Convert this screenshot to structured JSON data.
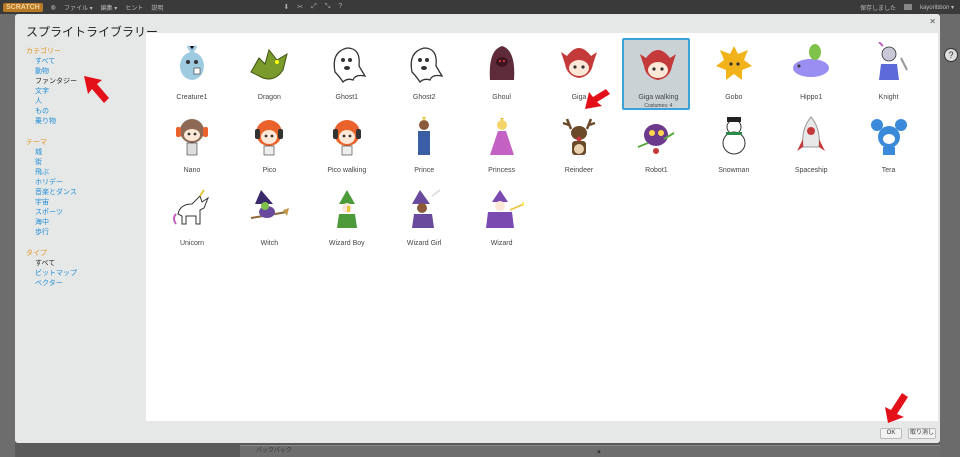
{
  "topbar": {
    "logo": "SCRATCH",
    "menus": [
      "ファイル ▾",
      "編集 ▾",
      "ヒント",
      "説明"
    ],
    "right_text": "保存しました",
    "user": "kayoribbon ▾"
  },
  "background": {
    "backpack_label": "バックパック"
  },
  "dialog": {
    "title": "スプライトライブラリー",
    "ok_label": "OK",
    "cancel_label": "取り消し"
  },
  "sidebar": {
    "category_heading": "カテゴリー",
    "categories": [
      "すべて",
      "動物",
      "ファンタジー",
      "文字",
      "人",
      "もの",
      "乗り物"
    ],
    "theme_heading": "テーマ",
    "themes": [
      "城",
      "街",
      "飛ぶ",
      "ホリデー",
      "音楽とダンス",
      "宇宙",
      "スポーツ",
      "海中",
      "歩行"
    ],
    "type_heading": "タイプ",
    "types": [
      "すべて",
      "ビットマップ",
      "ベクター"
    ]
  },
  "sprites": [
    {
      "name": "Creature1",
      "icon": "creature-icon",
      "color": "#9fcbe0"
    },
    {
      "name": "Dragon",
      "icon": "dragon-icon",
      "color": "#7a9a2c"
    },
    {
      "name": "Ghost1",
      "icon": "ghost-icon",
      "color": "#ffffff"
    },
    {
      "name": "Ghost2",
      "icon": "ghost-icon",
      "color": "#ffffff"
    },
    {
      "name": "Ghoul",
      "icon": "ghoul-icon",
      "color": "#5e2b3a"
    },
    {
      "name": "Giga",
      "icon": "giga-icon",
      "color": "#c43a3a"
    },
    {
      "name": "Giga walking",
      "icon": "giga-icon",
      "color": "#c43a3a",
      "sublabel": "Costumes: 4"
    },
    {
      "name": "Gobo",
      "icon": "gobo-icon",
      "color": "#f2b31a"
    },
    {
      "name": "Hippo1",
      "icon": "hippo-icon",
      "color": "#9b8ef2"
    },
    {
      "name": "Knight",
      "icon": "knight-icon",
      "color": "#5d6bd8"
    },
    {
      "name": "Nano",
      "icon": "nano-icon",
      "color": "#8c6a56"
    },
    {
      "name": "Pico",
      "icon": "pico-icon",
      "color": "#e9622c"
    },
    {
      "name": "Pico walking",
      "icon": "pico-icon",
      "color": "#e9622c"
    },
    {
      "name": "Prince",
      "icon": "prince-icon",
      "color": "#3a5ea3"
    },
    {
      "name": "Princess",
      "icon": "princess-icon",
      "color": "#c462c4"
    },
    {
      "name": "Reindeer",
      "icon": "reindeer-icon",
      "color": "#6b4a2a"
    },
    {
      "name": "Robot1",
      "icon": "robot-icon",
      "color": "#6b3a8c"
    },
    {
      "name": "Snowman",
      "icon": "snowman-icon",
      "color": "#f4f4f4"
    },
    {
      "name": "Spaceship",
      "icon": "spaceship-icon",
      "color": "#d9d9d9"
    },
    {
      "name": "Tera",
      "icon": "tera-icon",
      "color": "#3a8ad9"
    },
    {
      "name": "Unicorn",
      "icon": "unicorn-icon",
      "color": "#ffffff"
    },
    {
      "name": "Witch",
      "icon": "witch-icon",
      "color": "#6a4a9c"
    },
    {
      "name": "Wizard Boy",
      "icon": "wizard-boy-icon",
      "color": "#4c9a3a"
    },
    {
      "name": "Wizard Girl",
      "icon": "wizard-girl-icon",
      "color": "#6a4a9c"
    },
    {
      "name": "Wizard",
      "icon": "wizard-icon",
      "color": "#7a4ab0"
    }
  ],
  "colors": {
    "accent": "#3aa2d6",
    "heading": "#e39521",
    "link": "#1f8dd6",
    "annotation": "#e3101a"
  }
}
